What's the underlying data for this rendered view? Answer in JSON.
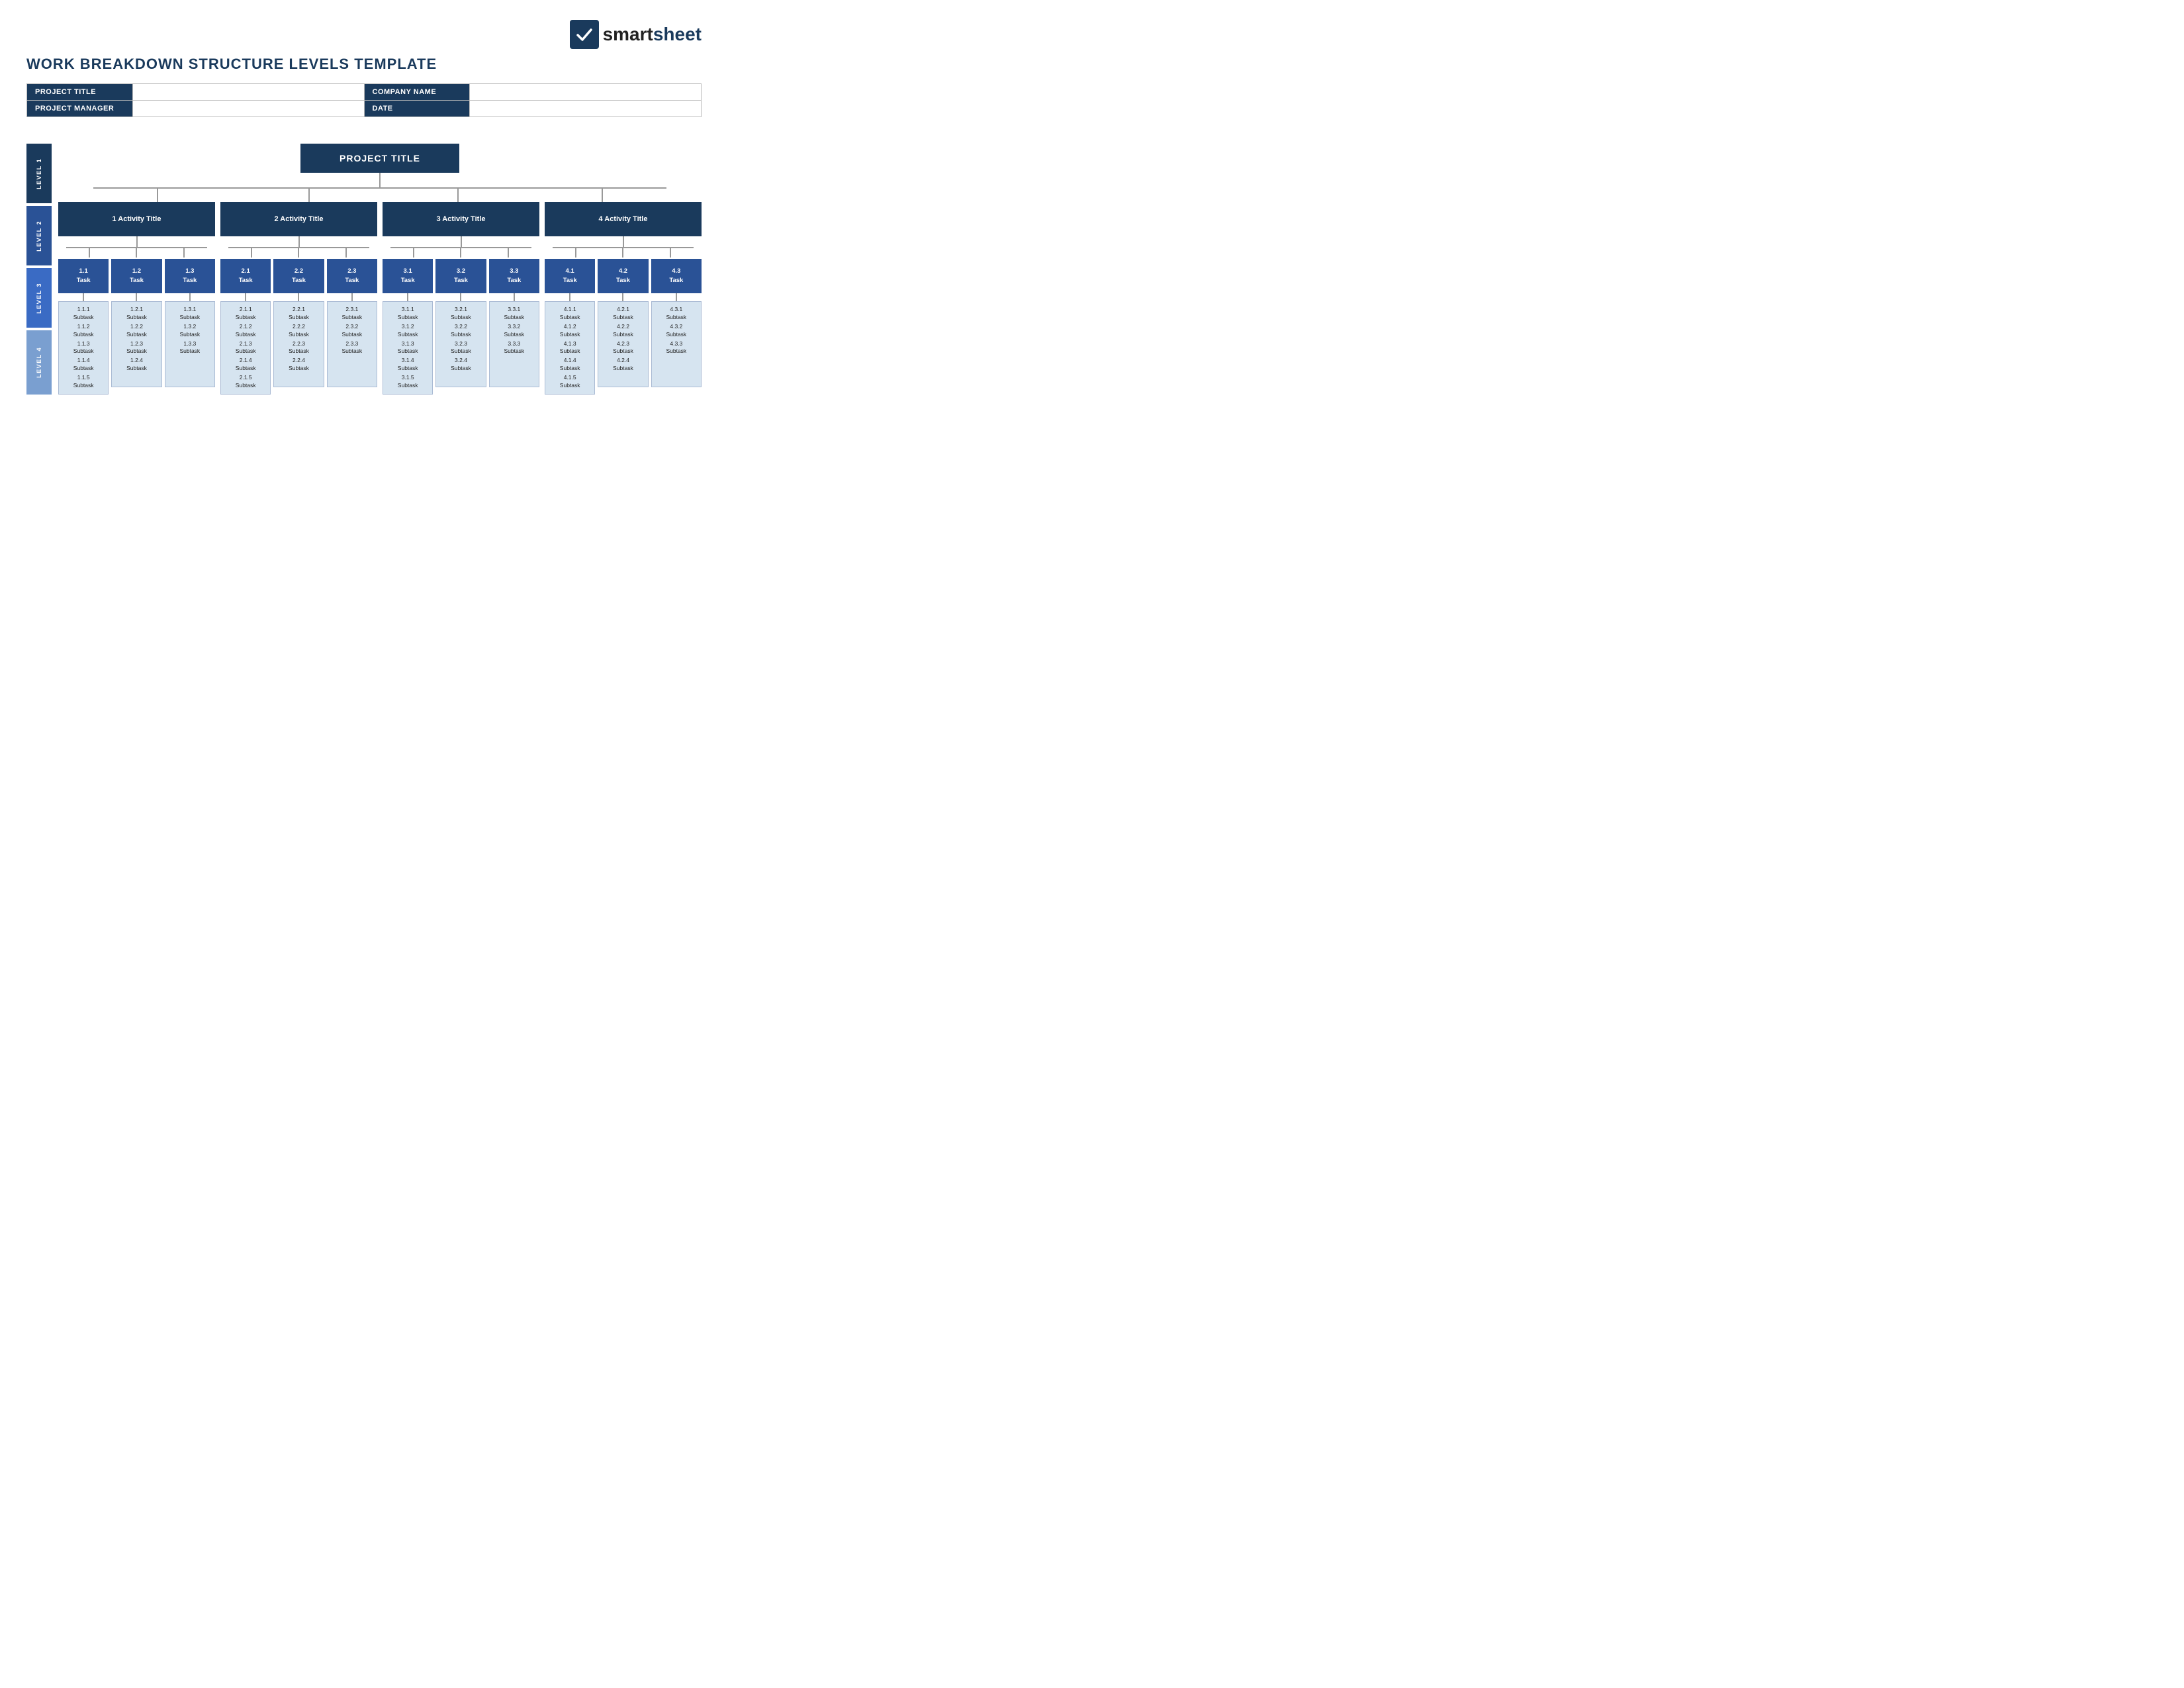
{
  "logo": {
    "text_plain": "smart",
    "text_bold": "sheet",
    "icon_check": "✓"
  },
  "page_title": "WORK BREAKDOWN STRUCTURE LEVELS TEMPLATE",
  "info_rows": [
    {
      "label1": "PROJECT TITLE",
      "value1": "",
      "label2": "COMPANY NAME",
      "value2": ""
    },
    {
      "label1": "PROJECT MANAGER",
      "value1": "",
      "label2": "DATE",
      "value2": ""
    }
  ],
  "levels": {
    "level1_label": "LEVEL 1",
    "level2_label": "LEVEL 2",
    "level3_label": "LEVEL 3",
    "level4_label": "LEVEL 4"
  },
  "project_title": "PROJECT TITLE",
  "activities": [
    {
      "title": "1 Activity Title",
      "tasks": [
        {
          "label": "1.1\nTask",
          "subtasks": [
            "1.1.1\nSubtask",
            "1.1.2\nSubtask",
            "1.1.3\nSubtask",
            "1.1.4\nSubtask",
            "1.1.5\nSubtask"
          ]
        },
        {
          "label": "1.2\nTask",
          "subtasks": [
            "1.2.1\nSubtask",
            "1.2.2\nSubtask",
            "1.2.3\nSubtask",
            "1.2.4\nSubtask"
          ]
        },
        {
          "label": "1.3\nTask",
          "subtasks": [
            "1.3.1\nSubtask",
            "1.3.2\nSubtask",
            "1.3.3\nSubtask"
          ]
        }
      ]
    },
    {
      "title": "2 Activity Title",
      "tasks": [
        {
          "label": "2.1\nTask",
          "subtasks": [
            "2.1.1\nSubtask",
            "2.1.2\nSubtask",
            "2.1.3\nSubtask",
            "2.1.4\nSubtask",
            "2.1.5\nSubtask"
          ]
        },
        {
          "label": "2.2\nTask",
          "subtasks": [
            "2.2.1\nSubtask",
            "2.2.2\nSubtask",
            "2.2.3\nSubtask",
            "2.2.4\nSubtask"
          ]
        },
        {
          "label": "2.3\nTask",
          "subtasks": [
            "2.3.1\nSubtask",
            "2.3.2\nSubtask",
            "2.3.3\nSubtask"
          ]
        }
      ]
    },
    {
      "title": "3 Activity Title",
      "tasks": [
        {
          "label": "3.1\nTask",
          "subtasks": [
            "3.1.1\nSubtask",
            "3.1.2\nSubtask",
            "3.1.3\nSubtask",
            "3.1.4\nSubtask",
            "3.1.5\nSubtask"
          ]
        },
        {
          "label": "3.2\nTask",
          "subtasks": [
            "3.2.1\nSubtask",
            "3.2.2\nSubtask",
            "3.2.3\nSubtask",
            "3.2.4\nSubtask"
          ]
        },
        {
          "label": "3.3\nTask",
          "subtasks": [
            "3.3.1\nSubtask",
            "3.3.2\nSubtask",
            "3.3.3\nSubtask"
          ]
        }
      ]
    },
    {
      "title": "4 Activity Title",
      "tasks": [
        {
          "label": "4.1\nTask",
          "subtasks": [
            "4.1.1\nSubtask",
            "4.1.2\nSubtask",
            "4.1.3\nSubtask",
            "4.1.4\nSubtask",
            "4.1.5\nSubtask"
          ]
        },
        {
          "label": "4.2\nTask",
          "subtasks": [
            "4.2.1\nSubtask",
            "4.2.2\nSubtask",
            "4.2.3\nSubtask",
            "4.2.4\nSubtask"
          ]
        },
        {
          "label": "4.3\nTask",
          "subtasks": [
            "4.3.1\nSubtask",
            "4.3.2\nSubtask",
            "4.3.3\nSubtask"
          ]
        }
      ]
    }
  ],
  "colors": {
    "dark_navy": "#1a3a5c",
    "medium_blue": "#2a5296",
    "light_blue_task": "#3a6bc4",
    "subtask_bg": "#d6e4f0",
    "subtask_border": "#aabbd4",
    "level2_sidebar": "#2a5296",
    "level3_sidebar": "#3a6bc4",
    "level4_sidebar": "#7a9fd0",
    "connector": "#999"
  }
}
